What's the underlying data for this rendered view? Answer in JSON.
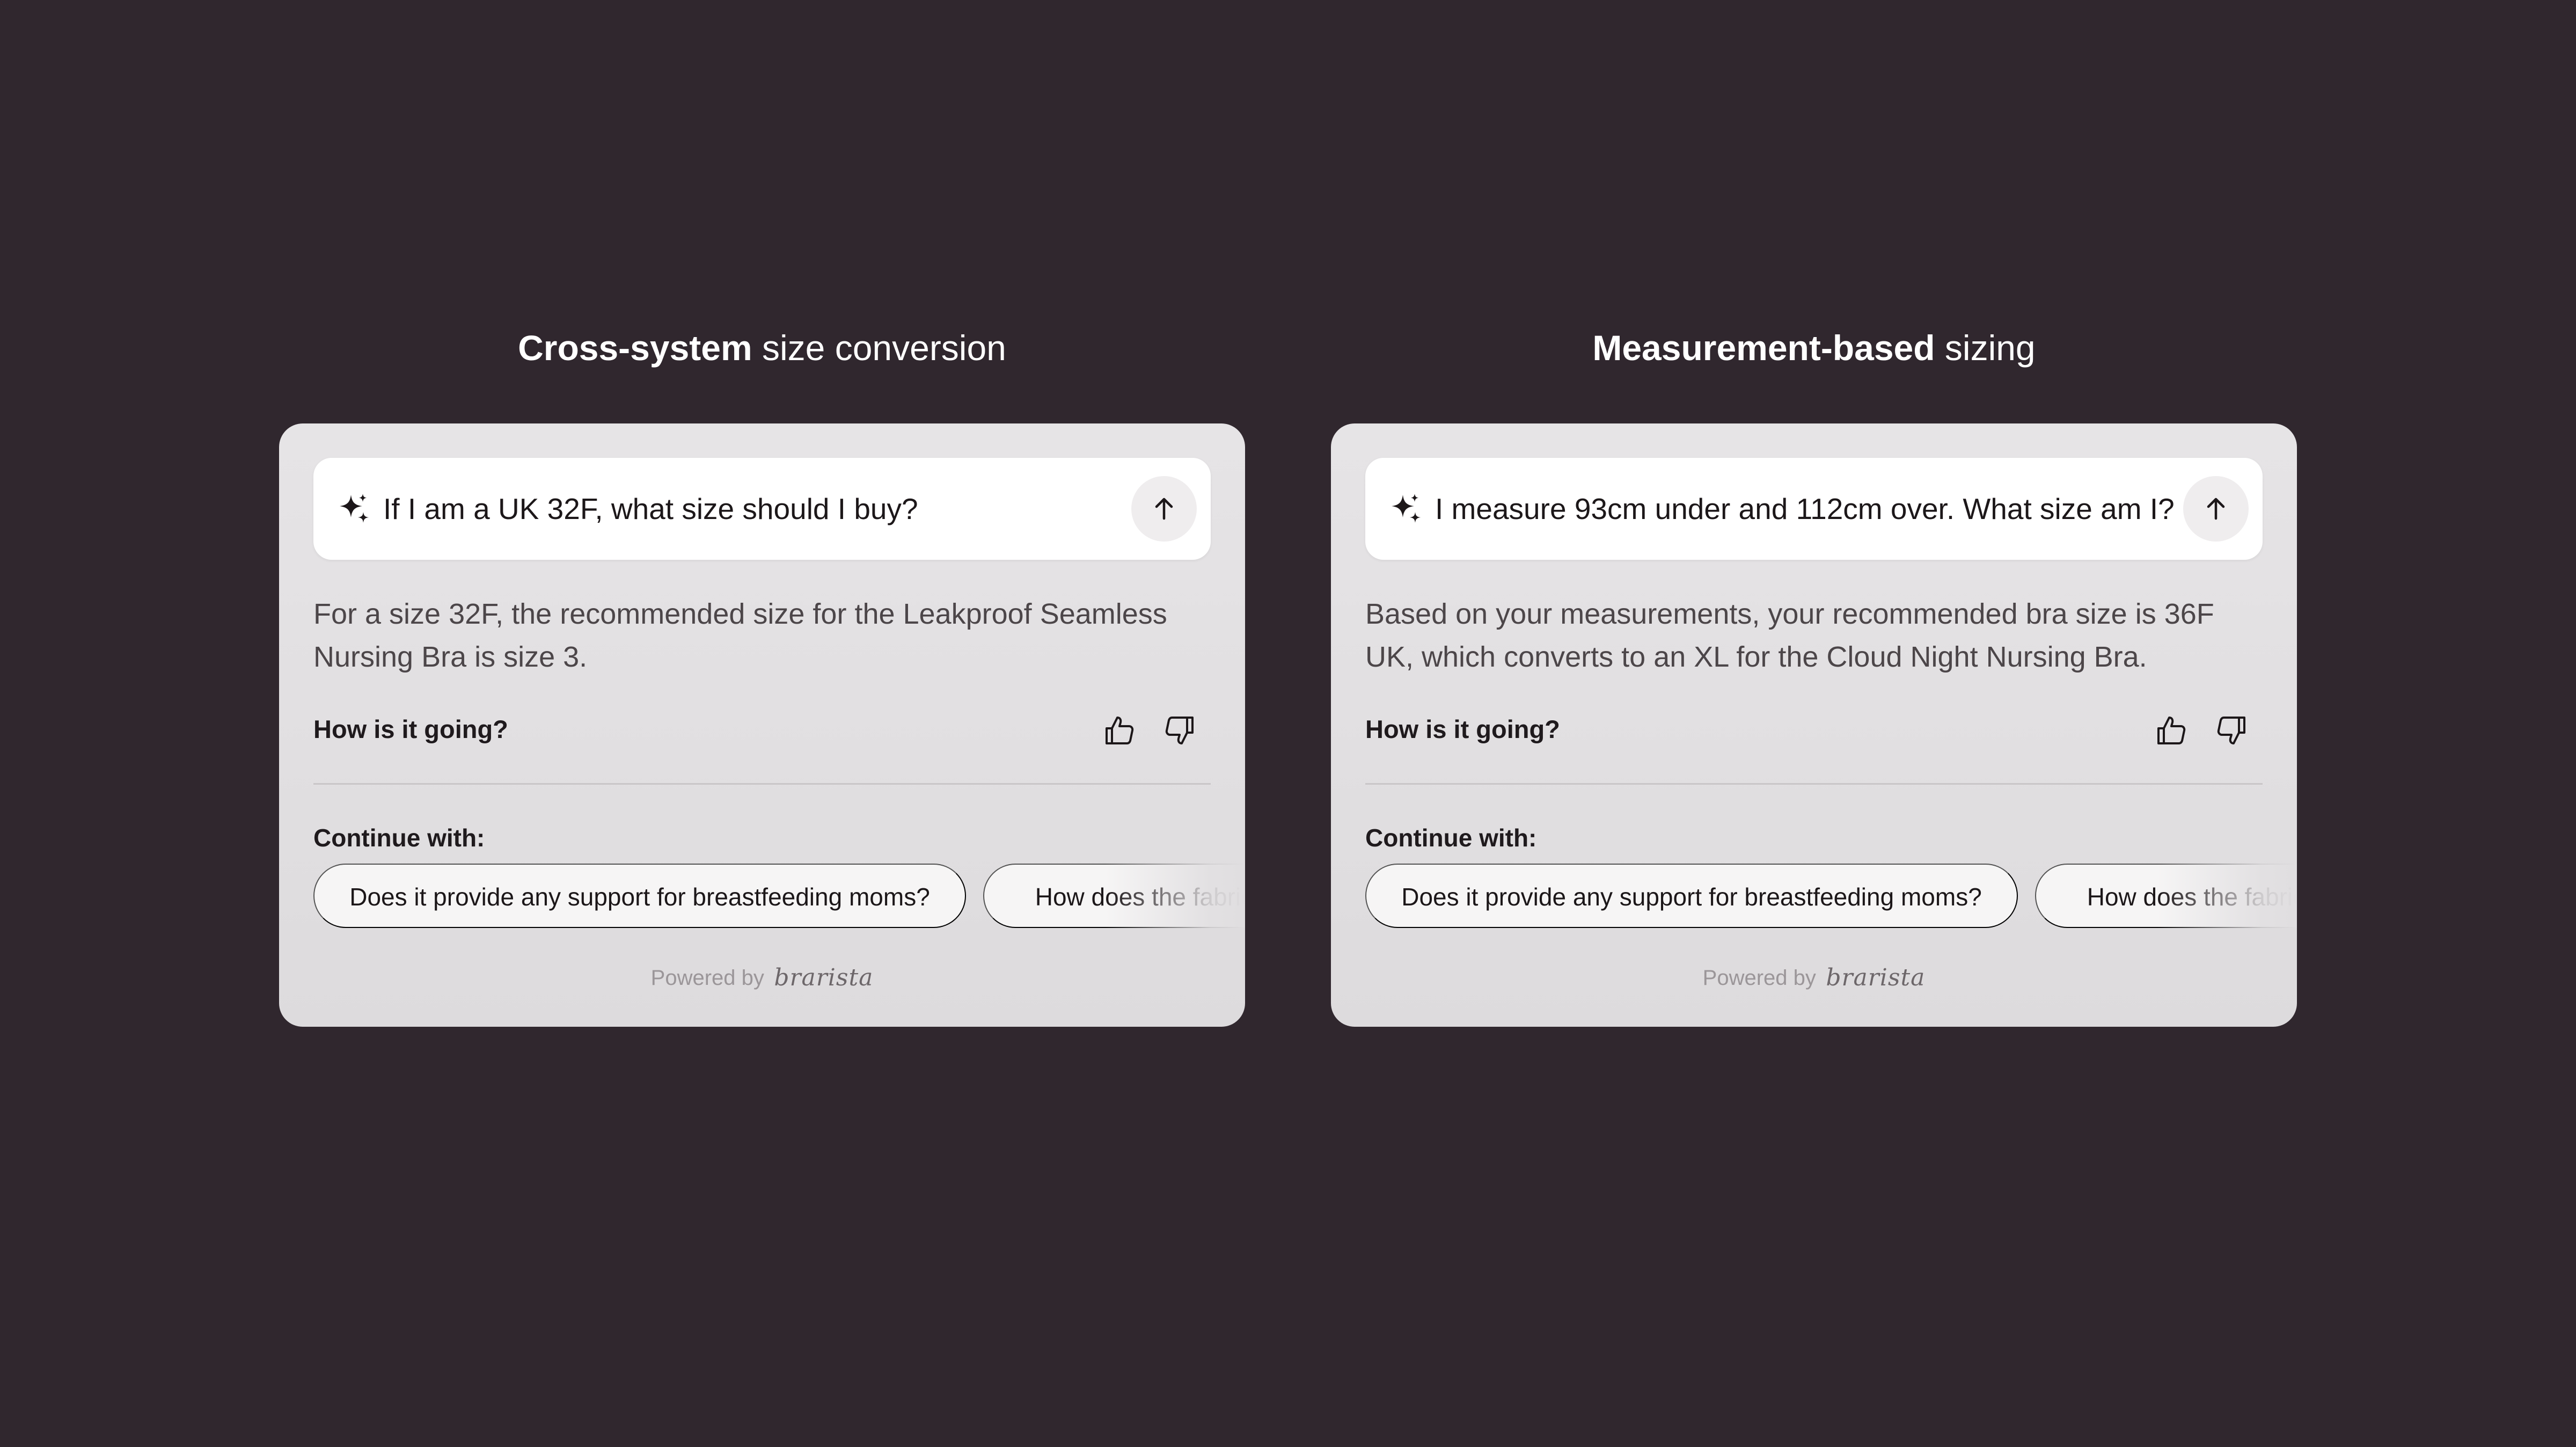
{
  "panels": [
    {
      "heading_bold": "Cross-system",
      "heading_rest": " size conversion",
      "query": "If I am a UK 32F, what size should I buy?",
      "answer": "For a size 32F, the recommended size for the Leakproof Seamless Nursing Bra is size 3.",
      "feedback_label": "How is it going?",
      "continue_label": "Continue with:",
      "suggestions": [
        "Does it provide any support for breastfeeding moms?",
        "How does the fabric"
      ],
      "powered_by": "Powered by",
      "brand": "brarista"
    },
    {
      "heading_bold": "Measurement-based",
      "heading_rest": " sizing",
      "query": "I measure 93cm under and 112cm over. What size am I?",
      "answer": "Based on your measurements, your recommended bra size is 36F UK, which converts to an XL for the Cloud Night Nursing Bra.",
      "feedback_label": "How is it going?",
      "continue_label": "Continue with:",
      "suggestions": [
        "Does it provide any support for breastfeeding moms?",
        "How does the fabric"
      ],
      "powered_by": "Powered by",
      "brand": "brarista"
    }
  ],
  "icons": {
    "sparkle": "sparkle-icon",
    "send": "arrow-up-icon",
    "like": "thumbs-up-icon",
    "dislike": "thumbs-down-icon"
  },
  "colors": {
    "background": "#30272e",
    "card": "#e2e0e2",
    "chip": "#f6f5f5",
    "text_dark": "#1c1719",
    "text_muted": "#4c4649"
  }
}
